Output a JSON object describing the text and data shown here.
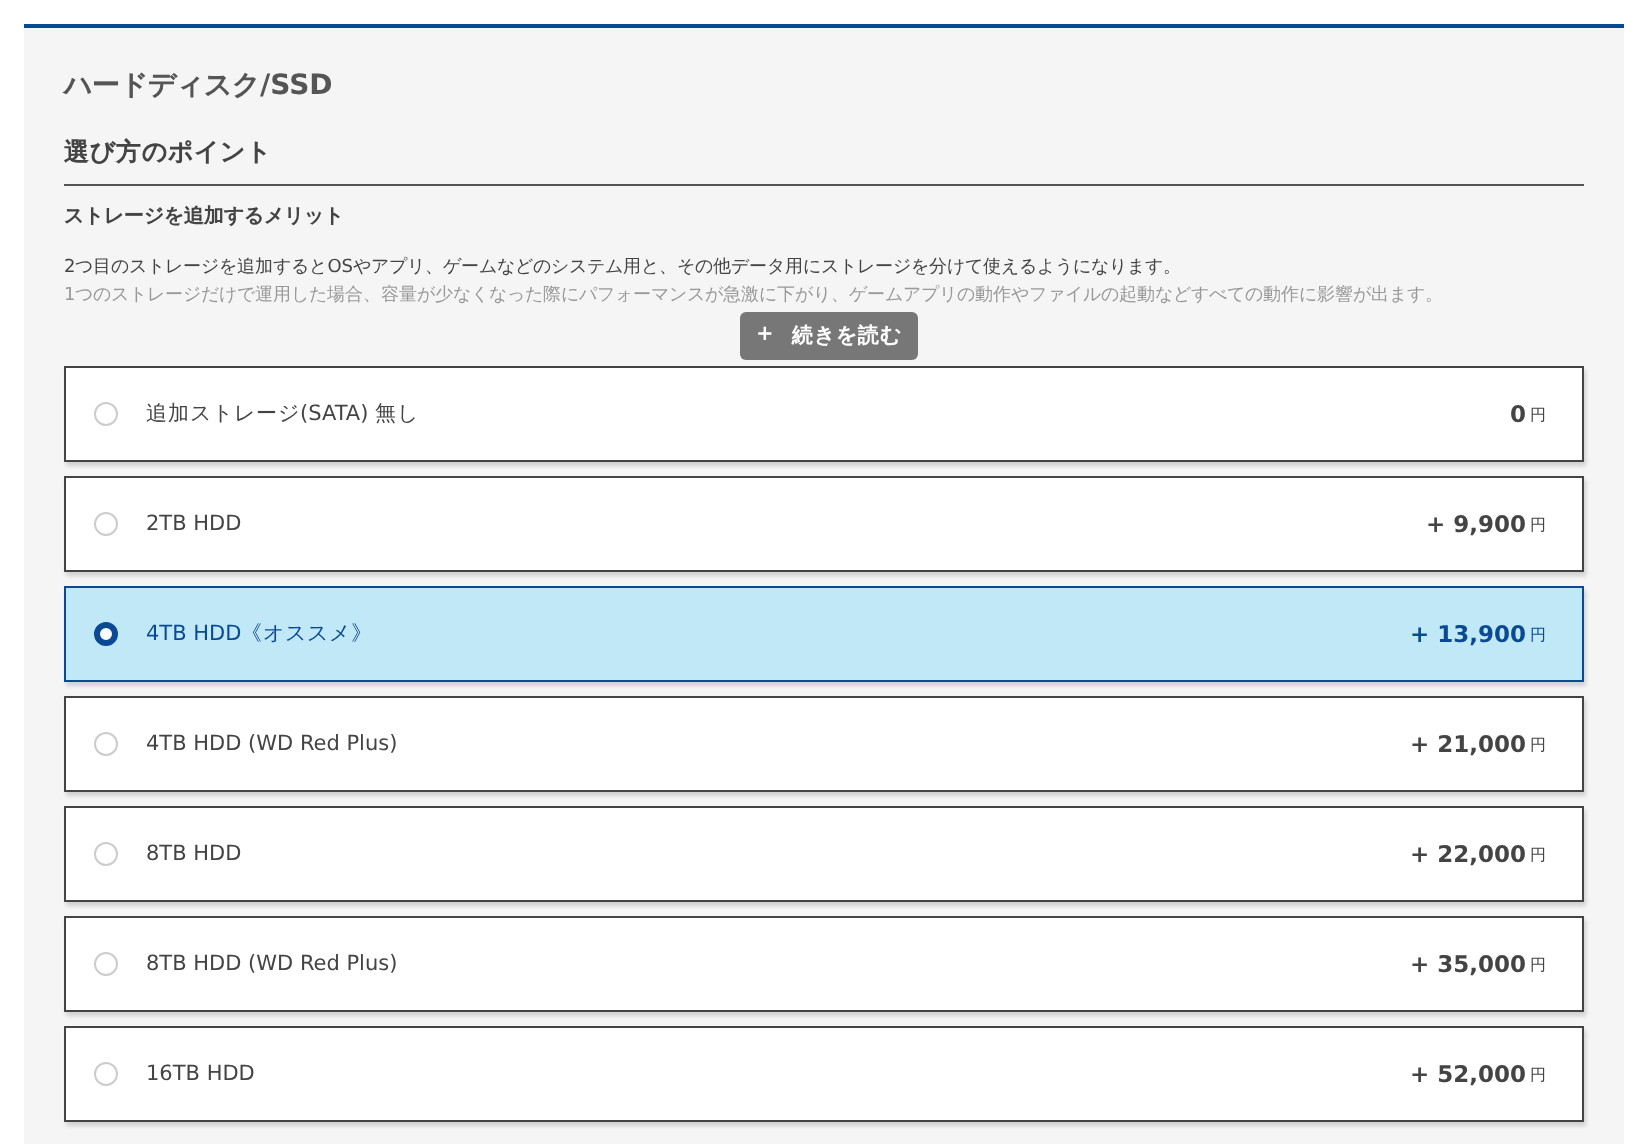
{
  "title": "ハードディスク/SSD",
  "section_heading": "選び方のポイント",
  "subheading": "ストレージを追加するメリット",
  "description": [
    "2つ目のストレージを追加するとOSやアプリ、ゲームなどのシステム用と、その他データ用にストレージを分けて使えるようになります。",
    "1つのストレージだけで運用した場合、容量が少なくなった際にパフォーマンスが急激に下がり、ゲームアプリの動作やファイルの起動などすべての動作に影響が出ます。"
  ],
  "read_more": {
    "icon": "+",
    "label": "続きを読む"
  },
  "options": [
    {
      "label": "追加ストレージ(SATA) 無し",
      "price": "0",
      "unit": "円",
      "selected": false
    },
    {
      "label": "2TB HDD",
      "price": "+ 9,900",
      "unit": "円",
      "selected": false
    },
    {
      "label": "4TB HDD《オススメ》",
      "price": "+ 13,900",
      "unit": "円",
      "selected": true
    },
    {
      "label": "4TB HDD (WD Red Plus)",
      "price": "+ 21,000",
      "unit": "円",
      "selected": false
    },
    {
      "label": "8TB HDD",
      "price": "+ 22,000",
      "unit": "円",
      "selected": false
    },
    {
      "label": "8TB HDD (WD Red Plus)",
      "price": "+ 35,000",
      "unit": "円",
      "selected": false
    },
    {
      "label": "16TB HDD",
      "price": "+ 52,000",
      "unit": "円",
      "selected": false
    }
  ]
}
